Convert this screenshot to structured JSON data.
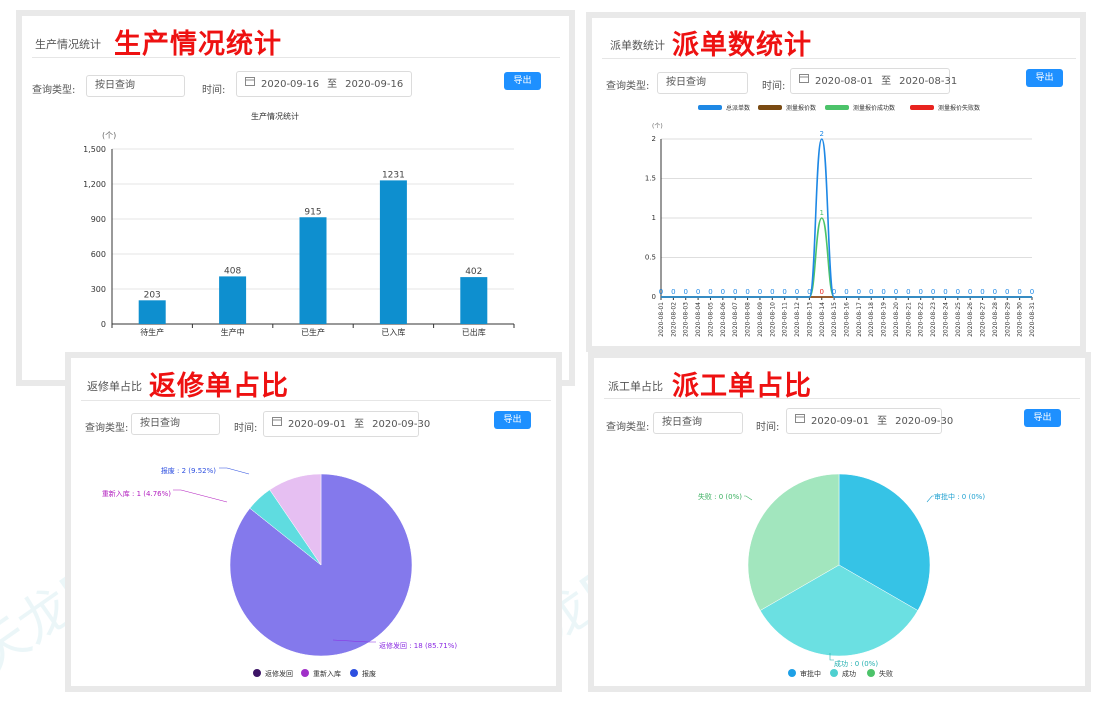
{
  "panels": {
    "production": {
      "title": "生产情况统计",
      "big_title": "生产情况统计",
      "query_label": "查询类型:",
      "query_value": "按日查询",
      "time_label": "时间:",
      "date_start": "2020-09-16",
      "date_sep": "至",
      "date_end": "2020-09-16",
      "export_label": "导出",
      "chart_title": "生产情况统计",
      "unit": "(个)"
    },
    "dispatch": {
      "title": "派单数统计",
      "big_title": "派单数统计",
      "query_label": "查询类型:",
      "query_value": "按日查询",
      "time_label": "时间:",
      "date_start": "2020-08-01",
      "date_sep": "至",
      "date_end": "2020-08-31",
      "export_label": "导出",
      "unit": "(个)"
    },
    "repair": {
      "title": "返修单占比",
      "big_title": "返修单占比",
      "query_label": "查询类型:",
      "query_value": "按日查询",
      "time_label": "时间:",
      "date_start": "2020-09-01",
      "date_sep": "至",
      "date_end": "2020-09-30",
      "export_label": "导出"
    },
    "work": {
      "title": "派工单占比",
      "big_title": "派工单占比",
      "query_label": "查询类型:",
      "query_value": "按日查询",
      "time_label": "时间:",
      "date_start": "2020-09-01",
      "date_sep": "至",
      "date_end": "2020-09-30",
      "export_label": "导出"
    }
  },
  "watermark": "天龙ERP",
  "chart_data": [
    {
      "type": "bar",
      "title": "生产情况统计",
      "ylabel": "(个)",
      "categories": [
        "待生产",
        "生产中",
        "已生产",
        "已入库",
        "已出库"
      ],
      "values": [
        203,
        408,
        915,
        1231,
        402
      ],
      "ylim": [
        0,
        1500
      ],
      "yticks": [
        "0",
        "300",
        "600",
        "900",
        "1,200",
        "1,500"
      ],
      "color": "#0e8fcf"
    },
    {
      "type": "line",
      "ylabel": "(个)",
      "x": [
        "2020-08-01",
        "2020-08-02",
        "2020-08-03",
        "2020-08-04",
        "2020-08-05",
        "2020-08-06",
        "2020-08-07",
        "2020-08-08",
        "2020-08-09",
        "2020-08-10",
        "2020-08-11",
        "2020-08-12",
        "2020-08-13",
        "2020-08-14",
        "2020-08-15",
        "2020-08-16",
        "2020-08-17",
        "2020-08-18",
        "2020-08-19",
        "2020-08-20",
        "2020-08-21",
        "2020-08-22",
        "2020-08-23",
        "2020-08-24",
        "2020-08-25",
        "2020-08-26",
        "2020-08-27",
        "2020-08-28",
        "2020-08-29",
        "2020-08-30",
        "2020-08-31"
      ],
      "ylim": [
        0,
        2
      ],
      "yticks": [
        "0",
        "0.5",
        "1",
        "1.5",
        "2"
      ],
      "series": [
        {
          "name": "总派单数",
          "color": "#1e88e5",
          "values": [
            0,
            0,
            0,
            0,
            0,
            0,
            0,
            0,
            0,
            0,
            0,
            0,
            0,
            2,
            0,
            0,
            0,
            0,
            0,
            0,
            0,
            0,
            0,
            0,
            0,
            0,
            0,
            0,
            0,
            0,
            0
          ]
        },
        {
          "name": "测量报价数",
          "color": "#7a4a12",
          "values": [
            0,
            0,
            0,
            0,
            0,
            0,
            0,
            0,
            0,
            0,
            0,
            0,
            0,
            0,
            0,
            0,
            0,
            0,
            0,
            0,
            0,
            0,
            0,
            0,
            0,
            0,
            0,
            0,
            0,
            0,
            0
          ]
        },
        {
          "name": "测量报价成功数",
          "color": "#4cc36a",
          "values": [
            0,
            0,
            0,
            0,
            0,
            0,
            0,
            0,
            0,
            0,
            0,
            0,
            0,
            1,
            0,
            0,
            0,
            0,
            0,
            0,
            0,
            0,
            0,
            0,
            0,
            0,
            0,
            0,
            0,
            0,
            0
          ]
        },
        {
          "name": "测量报价失败数",
          "color": "#e8231f",
          "values": [
            0,
            0,
            0,
            0,
            0,
            0,
            0,
            0,
            0,
            0,
            0,
            0,
            0,
            0,
            0,
            0,
            0,
            0,
            0,
            0,
            0,
            0,
            0,
            0,
            0,
            0,
            0,
            0,
            0,
            0,
            0
          ]
        }
      ]
    },
    {
      "type": "pie",
      "slices": [
        {
          "name": "返修发回",
          "value": 18,
          "label": "返修发回 : 18 (85.71%)",
          "color": "#8479ec",
          "legend_color": "#3c1466",
          "label_color": "#8a2be2"
        },
        {
          "name": "重新入库",
          "value": 1,
          "label": "重新入库 : 1 (4.76%)",
          "color": "#5fdce0",
          "legend_color": "#a030c8",
          "label_color": "#b21ebf"
        },
        {
          "name": "报废",
          "value": 2,
          "label": "报废 : 2 (9.52%)",
          "color": "#e6bff2",
          "legend_color": "#2d4fe0",
          "label_color": "#2d4fe0"
        }
      ]
    },
    {
      "type": "pie",
      "slices": [
        {
          "name": "审批中",
          "value": 0,
          "label": "审批中 : 0 (0%)",
          "color": "#36c3e6",
          "legend_color": "#1ea0e6",
          "label_color": "#1ea0d0"
        },
        {
          "name": "成功",
          "value": 0,
          "label": "成功 : 0 (0%)",
          "color": "#6be0e2",
          "legend_color": "#4ed0d0",
          "label_color": "#24b0b0"
        },
        {
          "name": "失败",
          "value": 0,
          "label": "失败 : 0 (0%)",
          "color": "#a2e6be",
          "legend_color": "#4cc36a",
          "label_color": "#3ab060"
        }
      ]
    }
  ]
}
